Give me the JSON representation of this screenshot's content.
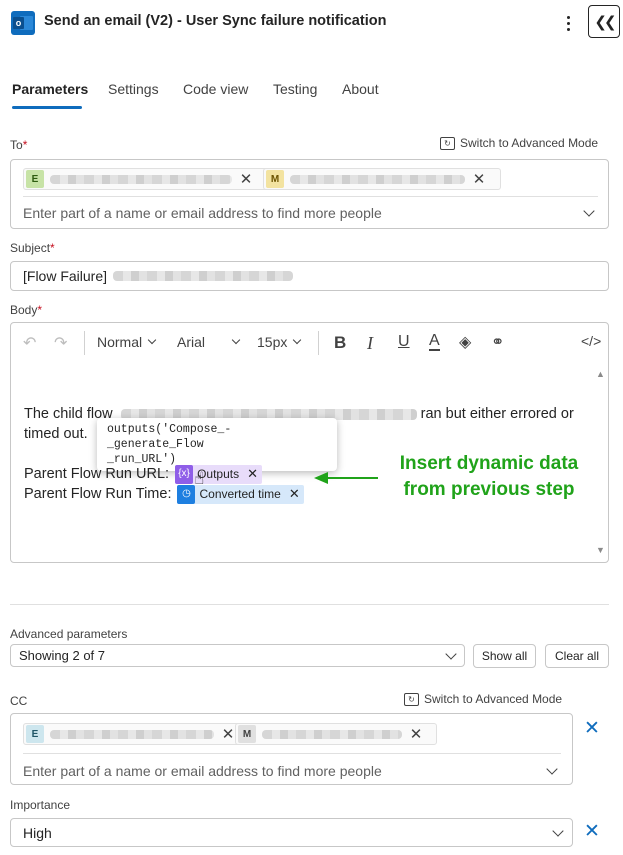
{
  "header": {
    "app_icon": "outlook-icon",
    "title": "Send an email (V2) - User Sync failure notification",
    "more_icon": "more-vertical-icon",
    "collapse_icon": "chevron-double-left-icon"
  },
  "tabs": [
    {
      "label": "Parameters",
      "active": true
    },
    {
      "label": "Settings",
      "active": false
    },
    {
      "label": "Code view",
      "active": false
    },
    {
      "label": "Testing",
      "active": false
    },
    {
      "label": "About",
      "active": false
    }
  ],
  "to": {
    "label": "To",
    "required": "*",
    "switch_label": "Switch to Advanced Mode",
    "chips": [
      {
        "initial": "E",
        "color": "#c7e3a6"
      },
      {
        "initial": "M",
        "color": "#f3e3a0"
      }
    ],
    "placeholder": "Enter part of a name or email address to find more people"
  },
  "subject": {
    "label": "Subject",
    "required": "*",
    "value_prefix": "[Flow Failure]"
  },
  "body": {
    "label": "Body",
    "required": "*",
    "toolbar": {
      "undo_icon": "undo-icon",
      "redo_icon": "redo-icon",
      "style": "Normal",
      "font": "Arial",
      "size": "15px",
      "bold_icon": "B",
      "italic_icon": "I",
      "underline_icon": "U",
      "font_color_icon": "A",
      "code_icon": "</>"
    },
    "text_line1_start": "The child flow",
    "text_line1_end": "ran but either errored or",
    "text_line2": "timed out.",
    "tooltip_line1": "outputs('Compose_-_generate_Flow",
    "tooltip_line2": "_run_URL')",
    "run_url_label": "Parent Flow Run URL:",
    "run_url_token": "Outputs",
    "run_time_label": "Parent Flow Run Time:",
    "run_time_token": "Converted time",
    "token_outputs_color": "#8f5ee8",
    "token_time_color": "#1e7fe0"
  },
  "annotation": {
    "line1": "Insert dynamic data",
    "line2": "from previous step",
    "color": "#20a31a"
  },
  "advanced": {
    "label": "Advanced parameters",
    "showing": "Showing 2 of 7",
    "show_all": "Show all",
    "clear_all": "Clear all"
  },
  "cc": {
    "label": "CC",
    "switch_label": "Switch to Advanced Mode",
    "chips": [
      {
        "initial": "E",
        "color": "#cde6ee"
      },
      {
        "initial": "M",
        "color": "#e0e0e0"
      }
    ],
    "placeholder": "Enter part of a name or email address to find more people"
  },
  "importance": {
    "label": "Importance",
    "value": "High"
  }
}
